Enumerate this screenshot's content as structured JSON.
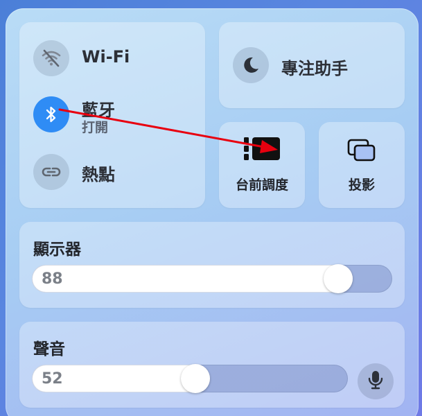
{
  "network": {
    "wifi": {
      "label": "Wi-Fi",
      "icon": "wifi-off-icon"
    },
    "bluetooth": {
      "label": "藍牙",
      "status": "打開",
      "icon": "bluetooth-icon"
    },
    "hotspot": {
      "label": "熱點",
      "icon": "hotspot-icon"
    }
  },
  "focus": {
    "label": "專注助手",
    "icon": "moon-icon"
  },
  "stage_manager": {
    "label": "台前調度",
    "icon": "stage-manager-icon"
  },
  "screen_mirroring": {
    "label": "投影",
    "icon": "screen-mirroring-icon"
  },
  "display": {
    "title": "顯示器",
    "brightness": 88
  },
  "sound": {
    "title": "聲音",
    "volume": 52,
    "mic_icon": "microphone-icon"
  },
  "colors": {
    "accent": "#2f8cf5",
    "annotation_arrow": "#e8000f"
  }
}
